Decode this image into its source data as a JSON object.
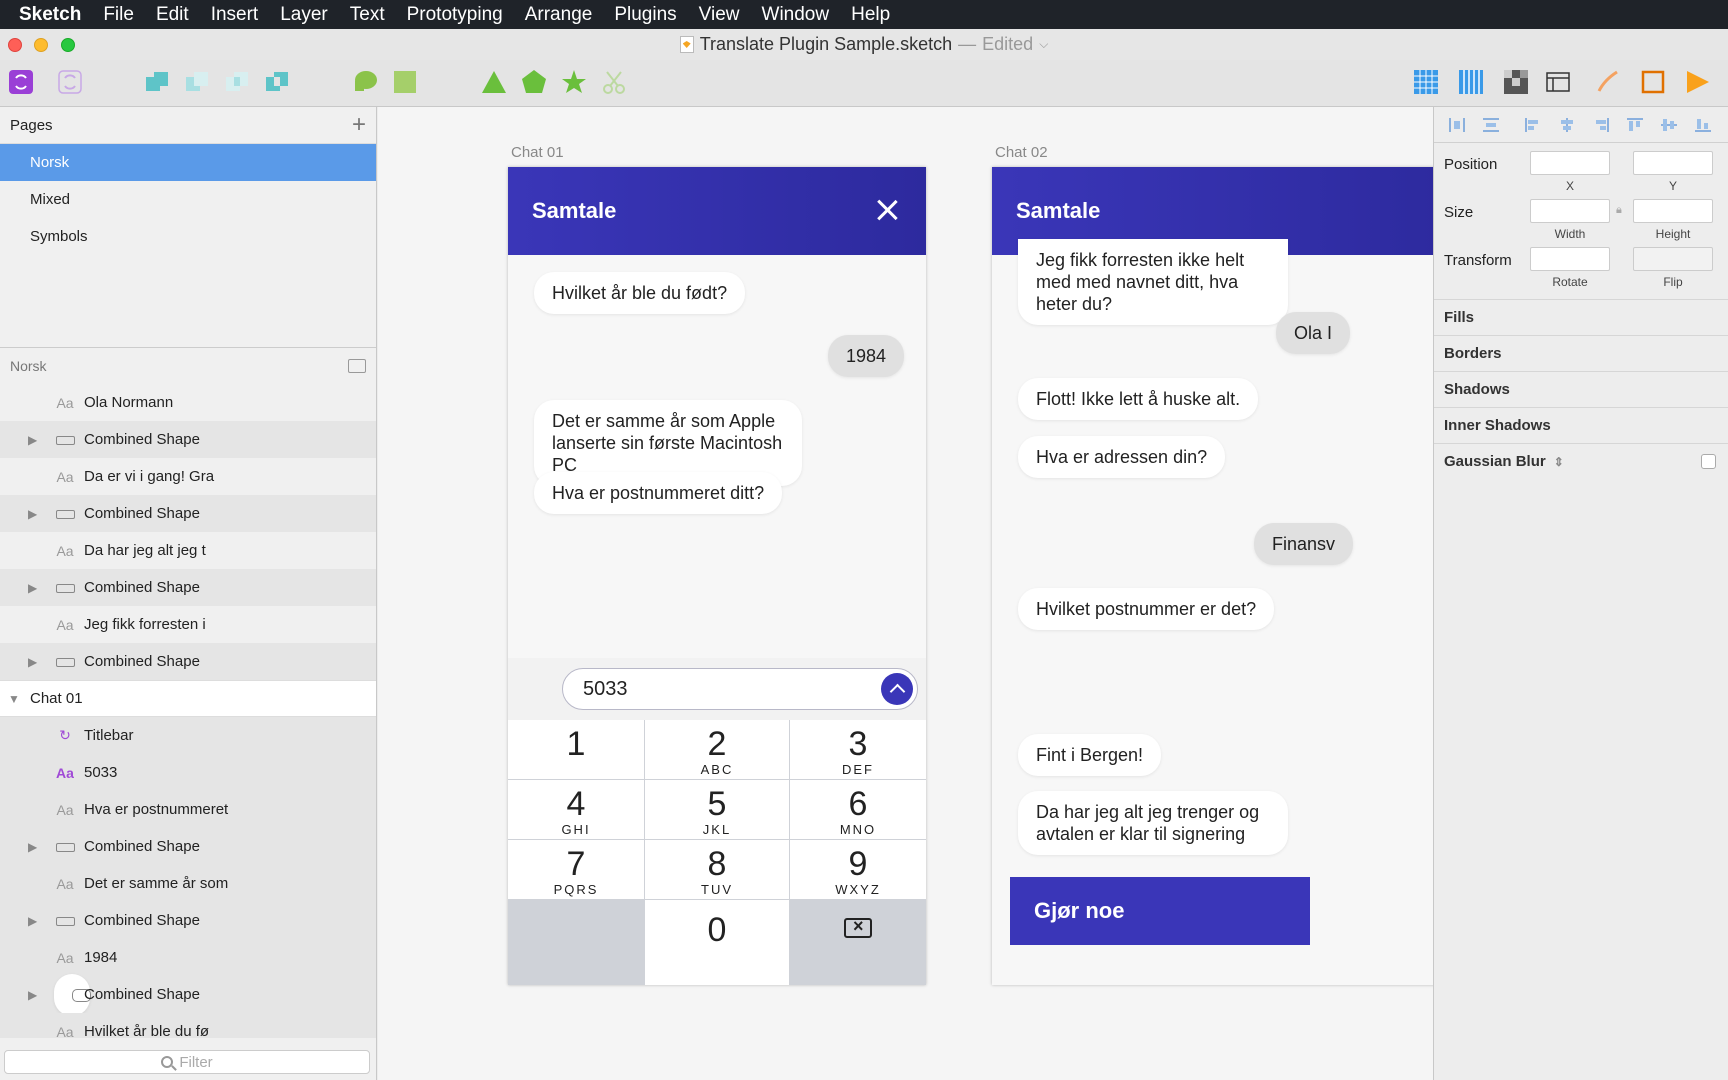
{
  "menubar": {
    "app": "Sketch",
    "items": [
      "File",
      "Edit",
      "Insert",
      "Layer",
      "Text",
      "Prototyping",
      "Arrange",
      "Plugins",
      "View",
      "Window",
      "Help"
    ]
  },
  "window": {
    "title": "Translate Plugin Sample.sketch",
    "separator": "—",
    "status": "Edited"
  },
  "toolbar": {
    "icons": [
      "symbol-create-icon",
      "symbol-detach-icon",
      "union-icon",
      "subtract-icon",
      "intersect-icon",
      "difference-icon",
      "mask-icon",
      "scale-icon",
      "triangle-icon",
      "pentagon-icon",
      "star-icon",
      "scissors-icon",
      "grid-icon",
      "layout-icon",
      "pixel-icon",
      "view-icon",
      "edit-icon",
      "artboard-icon",
      "preview-icon"
    ]
  },
  "pages": {
    "header": "Pages",
    "add_label": "+",
    "items": [
      {
        "label": "Norsk",
        "selected": true
      },
      {
        "label": "Mixed",
        "selected": false
      },
      {
        "label": "Symbols",
        "selected": false
      }
    ]
  },
  "layers": {
    "header": "Norsk",
    "rows": [
      {
        "type": "text",
        "label": "Ola Normann"
      },
      {
        "type": "shape",
        "label": "Combined Shape"
      },
      {
        "type": "text",
        "label": "Da er vi i gang! Gra"
      },
      {
        "type": "shape",
        "label": "Combined Shape"
      },
      {
        "type": "text",
        "label": "Da har jeg alt jeg t"
      },
      {
        "type": "shape",
        "label": "Combined Shape"
      },
      {
        "type": "text",
        "label": "Jeg fikk forresten i"
      },
      {
        "type": "shape",
        "label": "Combined Shape"
      },
      {
        "type": "group",
        "label": "Chat 01"
      },
      {
        "type": "symbol",
        "label": "Titlebar"
      },
      {
        "type": "text-active",
        "label": "5033"
      },
      {
        "type": "text",
        "label": "Hva er postnummeret"
      },
      {
        "type": "shape",
        "label": "Combined Shape"
      },
      {
        "type": "text",
        "label": "Det er samme år som"
      },
      {
        "type": "shape",
        "label": "Combined Shape"
      },
      {
        "type": "text",
        "label": "1984"
      },
      {
        "type": "bubble",
        "label": "Combined Shape"
      },
      {
        "type": "text",
        "label": "Hvilket år ble du fø"
      }
    ],
    "filter_placeholder": "Filter"
  },
  "chat01": {
    "label": "Chat 01",
    "header": "Samtale",
    "messages": [
      {
        "text": "Hvilket år ble du født?",
        "from": "bot"
      },
      {
        "text": "1984",
        "from": "user"
      },
      {
        "text": "Det er samme år som Apple lanserte sin første Macintosh PC",
        "from": "bot"
      },
      {
        "text": "Hva er postnummeret ditt?",
        "from": "bot"
      }
    ],
    "input_value": "5033",
    "keypad": [
      {
        "num": "1",
        "letters": ""
      },
      {
        "num": "2",
        "letters": "ABC"
      },
      {
        "num": "3",
        "letters": "DEF"
      },
      {
        "num": "4",
        "letters": "GHI"
      },
      {
        "num": "5",
        "letters": "JKL"
      },
      {
        "num": "6",
        "letters": "MNO"
      },
      {
        "num": "7",
        "letters": "PQRS"
      },
      {
        "num": "8",
        "letters": "TUV"
      },
      {
        "num": "9",
        "letters": "WXYZ"
      },
      {
        "num": "0",
        "letters": ""
      }
    ]
  },
  "chat02": {
    "label": "Chat 02",
    "header": "Samtale",
    "messages": [
      {
        "text": "Jeg fikk forresten ikke helt med med navnet ditt, hva heter du?",
        "from": "bot"
      },
      {
        "text": "Ola I",
        "from": "user"
      },
      {
        "text": "Flott! Ikke lett å huske alt.",
        "from": "bot"
      },
      {
        "text": "Hva er adressen din?",
        "from": "bot"
      },
      {
        "text": "Finansv",
        "from": "user"
      },
      {
        "text": "Hvilket postnummer er det?",
        "from": "bot"
      },
      {
        "text": "Fint i Bergen!",
        "from": "bot"
      },
      {
        "text": "Da har jeg alt jeg trenger og avtalen er klar til signering",
        "from": "bot"
      }
    ],
    "cta": "Gjør noe"
  },
  "inspector": {
    "position_label": "Position",
    "x_label": "X",
    "y_label": "Y",
    "size_label": "Size",
    "width_label": "Width",
    "height_label": "Height",
    "transform_label": "Transform",
    "rotate_label": "Rotate",
    "flip_label": "Flip",
    "sections": [
      "Fills",
      "Borders",
      "Shadows",
      "Inner Shadows",
      "Gaussian Blur"
    ]
  },
  "colors": {
    "accent": "#3a36b8",
    "selection": "#5a9ae8",
    "menubar": "#1f2329"
  }
}
